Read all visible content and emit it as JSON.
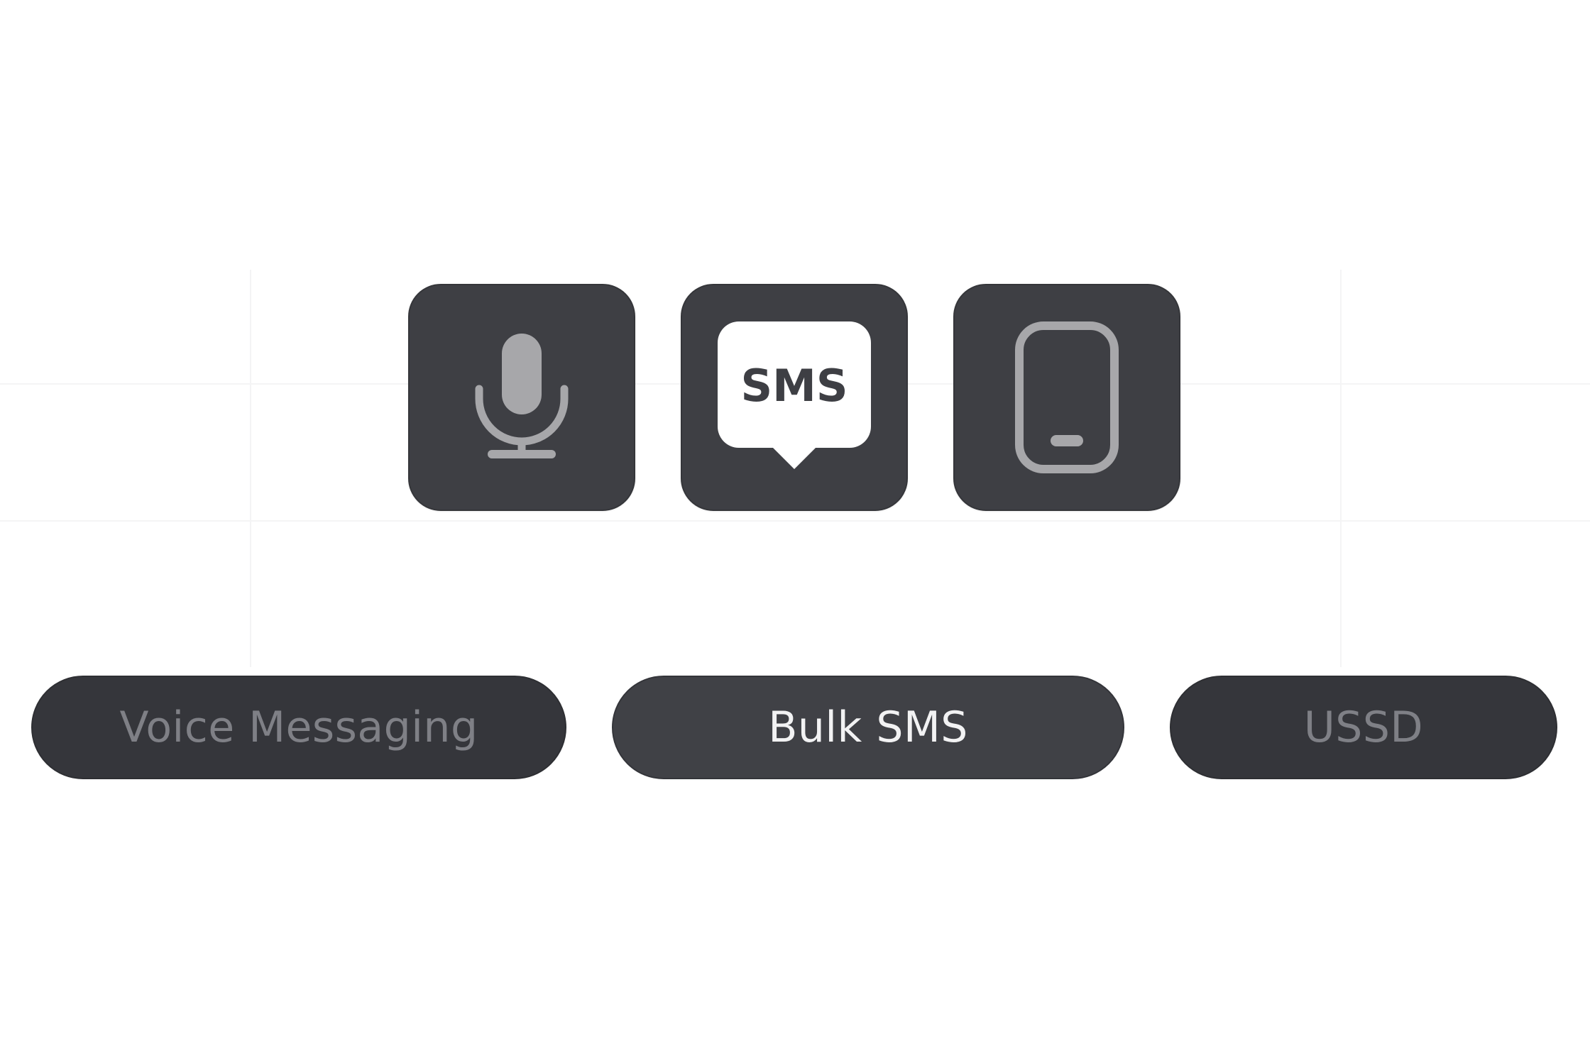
{
  "icons": [
    {
      "name": "microphone-icon",
      "sms_text": ""
    },
    {
      "name": "sms-bubble-icon",
      "sms_text": "SMS"
    },
    {
      "name": "mobile-phone-icon",
      "sms_text": ""
    }
  ],
  "tabs": [
    {
      "label": "Voice Messaging",
      "state": "inactive"
    },
    {
      "label": "Bulk SMS",
      "state": "active"
    },
    {
      "label": "USSD",
      "state": "inactive"
    }
  ],
  "colors": {
    "tile_bg": "#3e3f44",
    "icon_gray": "#a7a7aa",
    "bubble_white": "#ffffff",
    "active_text": "#f2f2f3",
    "inactive_text": "#7f8086"
  }
}
